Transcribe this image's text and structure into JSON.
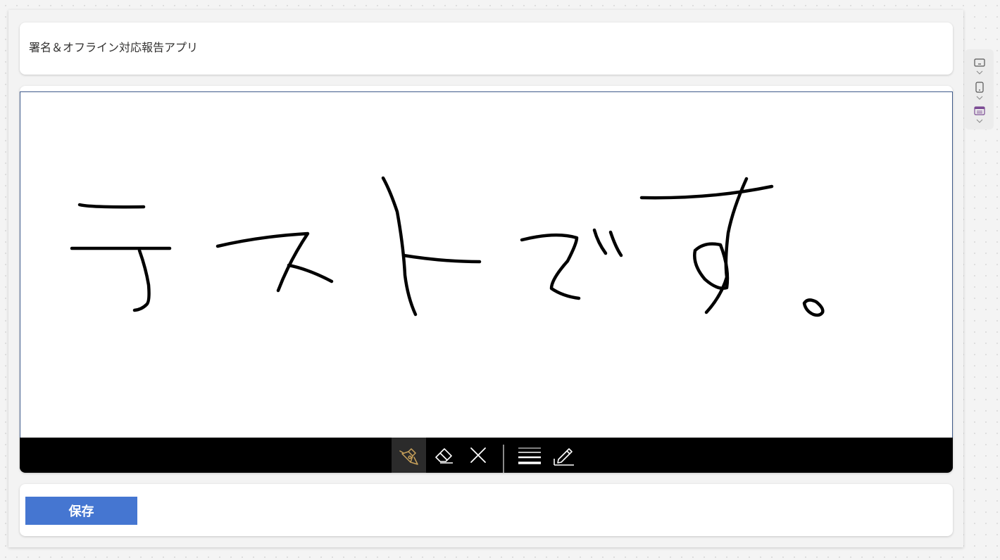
{
  "app": {
    "title": "署名＆オフライン対応報告アプリ"
  },
  "pen_input": {
    "ink_color": "#000000",
    "toolbar": {
      "tools": [
        {
          "name": "pen-icon",
          "active": true,
          "accent": "#c8a15a"
        },
        {
          "name": "eraser-icon",
          "active": false
        },
        {
          "name": "clear-icon",
          "active": false
        },
        {
          "name": "stroke-width-icon",
          "active": false
        },
        {
          "name": "pen-color-icon",
          "active": false
        }
      ]
    }
  },
  "actions": {
    "save_label": "保存"
  },
  "side_rail": {
    "items": [
      {
        "name": "layout-desktop-icon"
      },
      {
        "name": "layout-phone-icon"
      },
      {
        "name": "layout-tablet-icon",
        "accent": "#7b4b94"
      }
    ]
  },
  "colors": {
    "save_button": "#4576d1",
    "toolbar_bg": "#000000",
    "pen_border": "#3f5a8a"
  }
}
